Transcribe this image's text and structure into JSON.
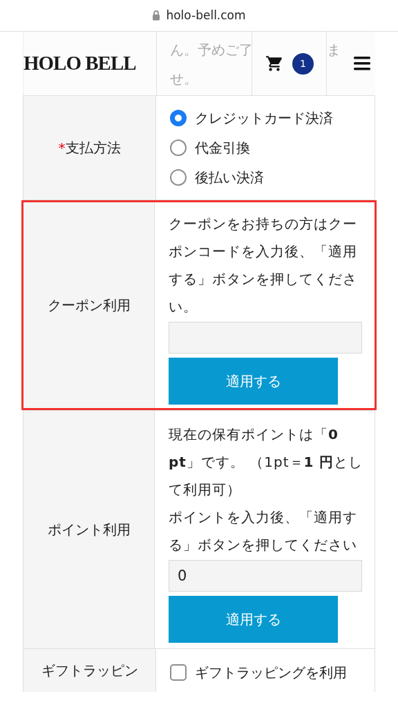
{
  "address_bar": {
    "url": "holo-bell.com"
  },
  "header": {
    "logo": "HOLO BELL",
    "behind_text": [
      [
        "ん。予めご了",
        "ま"
      ],
      [
        "せ。"
      ]
    ],
    "cart_count": "1"
  },
  "form": {
    "rows": [
      {
        "kind": "radio",
        "required_mark": "*",
        "label": "支払方法",
        "options": [
          {
            "label": "クレジットカード決済",
            "selected": true
          },
          {
            "label": "代金引換",
            "selected": false
          },
          {
            "label": "後払い決済",
            "selected": false
          }
        ]
      },
      {
        "kind": "coupon",
        "label": "クーポン利用",
        "highlighted": true,
        "description": "クーポンをお持ちの方はクーポンコードを入力後、「適用する」ボタンを押してください。",
        "button": "適用する"
      },
      {
        "kind": "points",
        "label": "ポイント利用",
        "description": "現在の保有ポイントは「**0 pt**」です。 （1pt＝**1 円**として利用可）",
        "instruction": "ポイントを入力後、「適用する」ボタンを押してください",
        "value": "0",
        "button": "適用する"
      },
      {
        "kind": "checkbox",
        "label": "ギフトラッピン",
        "options": [
          {
            "label": "ギフトラッピングを利用",
            "checked": false
          }
        ]
      }
    ]
  }
}
